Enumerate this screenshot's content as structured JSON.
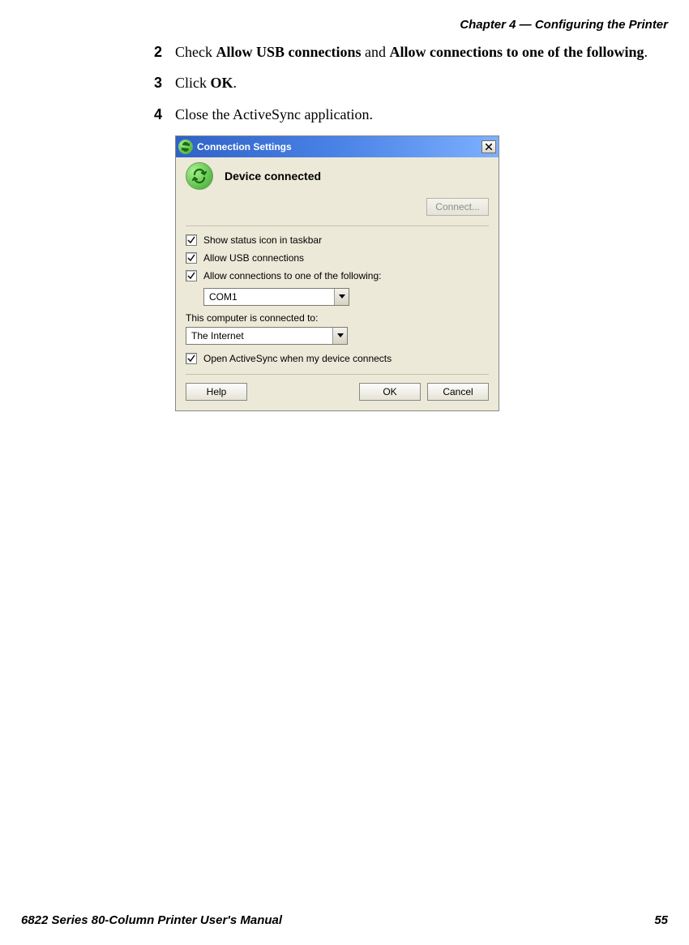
{
  "header": {
    "chapter": "Chapter 4 — Configuring the Printer"
  },
  "steps": [
    {
      "num": "2",
      "prefix": "Check ",
      "bold1": "Allow USB connections",
      "mid": " and ",
      "bold2": "Allow connections to one of the following",
      "suffix": "."
    },
    {
      "num": "3",
      "prefix": "Click ",
      "bold1": "OK",
      "mid": "",
      "bold2": "",
      "suffix": "."
    },
    {
      "num": "4",
      "prefix": "Close the ActiveSync application.",
      "bold1": "",
      "mid": "",
      "bold2": "",
      "suffix": ""
    }
  ],
  "dialog": {
    "title": "Connection Settings",
    "status": "Device connected",
    "connect_btn": "Connect...",
    "checkboxes": {
      "show_status": "Show status icon in taskbar",
      "allow_usb": "Allow USB connections",
      "allow_conn": "Allow connections to one of the following:",
      "open_activesync": "Open ActiveSync when my device connects"
    },
    "com_value": "COM1",
    "connected_to_label": "This computer is connected to:",
    "connected_to_value": "The Internet",
    "buttons": {
      "help": "Help",
      "ok": "OK",
      "cancel": "Cancel"
    }
  },
  "footer": {
    "title": "6822 Series 80-Column Printer User's Manual",
    "page": "55"
  }
}
